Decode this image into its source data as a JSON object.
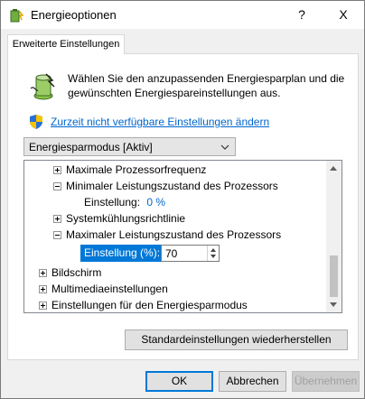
{
  "window": {
    "title": "Energieoptionen",
    "help_label": "?",
    "close_label": "X",
    "icon": "power-options-icon"
  },
  "tab": {
    "label": "Erweiterte Einstellungen"
  },
  "description": "Wählen Sie den anzupassenden Energiesparplan und die gewünschten Energiespareinstellungen aus.",
  "link": {
    "label": "Zurzeit nicht verfügbare Einstellungen ändern",
    "icon": "uac-shield-icon"
  },
  "plan_select": {
    "value": "Energiesparmodus [Aktiv]"
  },
  "tree": {
    "items": [
      {
        "label": "Maximale Prozessorfrequenz",
        "state": "collapsed"
      },
      {
        "label": "Minimaler Leistungszustand des Prozessors",
        "state": "expanded"
      },
      {
        "setting_label": "Einstellung:",
        "setting_value": "0 %"
      },
      {
        "label": "Systemkühlungsrichtlinie",
        "state": "collapsed"
      },
      {
        "label": "Maximaler Leistungszustand des Prozessors",
        "state": "expanded"
      },
      {
        "setting_label": "Einstellung (%):",
        "setting_value": "70"
      },
      {
        "label": "Bildschirm",
        "state": "collapsed"
      },
      {
        "label": "Multimediaeinstellungen",
        "state": "collapsed"
      },
      {
        "label": "Einstellungen für den Energiesparmodus",
        "state": "collapsed"
      }
    ]
  },
  "buttons": {
    "restore_defaults": "Standardeinstellungen wiederherstellen",
    "ok": "OK",
    "cancel": "Abbrechen",
    "apply": "Übernehmen"
  },
  "colors": {
    "accent": "#0078d7",
    "link": "#0066cc"
  }
}
